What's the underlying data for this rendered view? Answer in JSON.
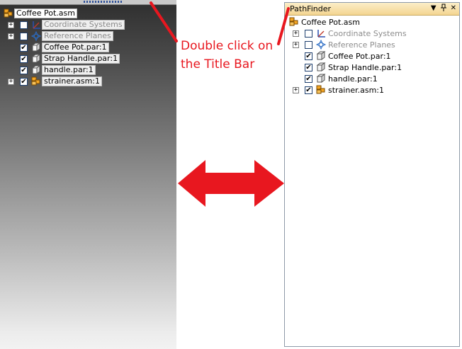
{
  "left_tree": {
    "root": "Coffee Pot.asm",
    "items": [
      {
        "label": "Coordinate Systems",
        "expander": "+",
        "checked": false,
        "dim": true,
        "icon": "coordinate-system-icon"
      },
      {
        "label": "Reference Planes",
        "expander": "+",
        "checked": false,
        "dim": true,
        "icon": "reference-planes-icon"
      },
      {
        "label": "Coffee Pot.par:1",
        "expander": "",
        "checked": true,
        "dim": false,
        "icon": "part-icon"
      },
      {
        "label": "Strap Handle.par:1",
        "expander": "",
        "checked": true,
        "dim": false,
        "icon": "part-icon"
      },
      {
        "label": "handle.par:1",
        "expander": "",
        "checked": true,
        "dim": false,
        "icon": "part-icon"
      },
      {
        "label": "strainer.asm:1",
        "expander": "+",
        "checked": true,
        "dim": false,
        "icon": "assembly-icon"
      }
    ]
  },
  "pathfinder": {
    "title": "PathFinder",
    "buttons": {
      "dropdown": "▼",
      "pin": "📌",
      "close": "✕"
    },
    "root": "Coffee Pot.asm",
    "items": [
      {
        "label": "Coordinate Systems",
        "expander": "+",
        "checked": false,
        "dim": true,
        "icon": "coordinate-system-icon"
      },
      {
        "label": "Reference Planes",
        "expander": "+",
        "checked": false,
        "dim": true,
        "icon": "reference-planes-icon"
      },
      {
        "label": "Coffee Pot.par:1",
        "expander": "",
        "checked": true,
        "dim": false,
        "icon": "part-icon"
      },
      {
        "label": "Strap Handle.par:1",
        "expander": "",
        "checked": true,
        "dim": false,
        "icon": "part-icon"
      },
      {
        "label": "handle.par:1",
        "expander": "",
        "checked": true,
        "dim": false,
        "icon": "part-icon"
      },
      {
        "label": "strainer.asm:1",
        "expander": "+",
        "checked": true,
        "dim": false,
        "icon": "assembly-icon"
      }
    ]
  },
  "annotation": {
    "line1": "Double click on",
    "line2": "the Title Bar",
    "color": "#e8171f"
  },
  "colors": {
    "titlebar": "#f4d591",
    "check_border": "#1e3f6e",
    "arrow": "#e8171f"
  }
}
